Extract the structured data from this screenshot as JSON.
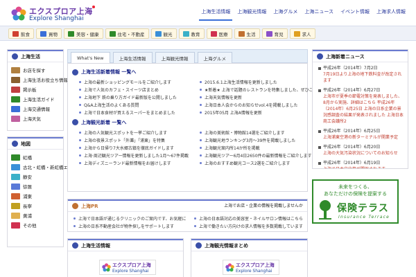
{
  "header": {
    "logo_jp": "エクスプロア上海",
    "logo_en": "Explore Shanghai",
    "nav": [
      "上海生活情報",
      "上海観光情報",
      "上海グルメ",
      "上海ニュース",
      "イベント情報",
      "上海求人情報"
    ]
  },
  "categories": [
    {
      "label": "飲食",
      "color": "#d04030"
    },
    {
      "label": "買物",
      "color": "#3a6fd8"
    },
    {
      "label": "美容・健康",
      "color": "#2f8a2a"
    },
    {
      "label": "住宅・不動産",
      "color": "#2f8a2a"
    },
    {
      "label": "観光",
      "color": "#3a8fd8"
    },
    {
      "label": "教育",
      "color": "#3ab0c8"
    },
    {
      "label": "医療",
      "color": "#d03050"
    },
    {
      "label": "生活",
      "color": "#c07030"
    },
    {
      "label": "育児",
      "color": "#8a50c8"
    },
    {
      "label": "求人",
      "color": "#e0a020"
    }
  ],
  "sidebar_top": {
    "title": "上海生活",
    "items": [
      {
        "label": "お店を探す",
        "color": "#b08040"
      },
      {
        "label": "上海生活お役立ち情報",
        "color": "#8a6030"
      },
      {
        "label": "掲示板",
        "color": "#c04040"
      },
      {
        "label": "上海生活ガイド",
        "color": "#2f8a2a"
      },
      {
        "label": "上海交通情報",
        "color": "#3a6fd8"
      },
      {
        "label": "上海天気",
        "color": "#c060a0"
      }
    ]
  },
  "sidebar_bottom": {
    "title": "地図",
    "items": [
      {
        "label": "虹橋",
        "color": "#2f8a2a"
      },
      {
        "label": "古北・虹橋・新虹橋エリア",
        "color": "#3a8fd8"
      },
      {
        "label": "静安",
        "color": "#3ab0c8"
      },
      {
        "label": "徐匯",
        "color": "#5a7ad8"
      },
      {
        "label": "浦東",
        "color": "#d06030"
      },
      {
        "label": "長寧",
        "color": "#c0a020"
      },
      {
        "label": "黄浦",
        "color": "#e0b050"
      },
      {
        "label": "その他",
        "color": "#d03050"
      }
    ]
  },
  "tabs": [
    "What's New",
    "上海生活情報",
    "上海観光情報",
    "上海グルメ"
  ],
  "whats_new": {
    "title1": "上海生活新着情報 一覧へ",
    "left1": [
      "上海の最新ショッピングモールをご紹介します",
      "上海で人気のカフェ・スイーツ店まとめ",
      "上海地下 鉄の乗り方ガイド最新版を公開しました",
      "Q&A上海生活のよくある質問",
      "上海で日本食材が買えるスーパーをまとめました"
    ],
    "right1": [
      "2015.6.1上海生活情報を更新しました",
      "★新着★ 上海で話題のレストランを特集しました、ぜひご覧ください",
      "上海天気情報を更新",
      "上海日本人会からのお知らせvol.4を掲載しました",
      "2015年05月 上海A情報を更新"
    ],
    "title2": "上海観光新着 一覧へ",
    "left2": [
      "上海の人気観光スポットを一挙ご紹介します",
      "上海の夜景スポット「外灘」「浦東」を特集",
      "上海から日帰り7大水郷古鎮を徹底ガイドします",
      "上海·周辺観光ツアー情報を更新しました1月〜67件掲載",
      "上海ディズニーランド最新情報をお届けします"
    ],
    "right2": [
      "上海の美術館・博物館14選をご紹介します",
      "上海観光地ランキング3月〜39件を掲載しました",
      "上海観光案内所14か所を掲載",
      "上海観光ツアー6月4日2650件の最新情報をご紹介します",
      "上海のおすすめ観光コース2選をご紹介します"
    ]
  },
  "pr": {
    "title": "上海PR",
    "right_text": "上海でお店・企業の情報を掲載しませんか",
    "left": [
      "上海で日本語が通じるクリニックのご案内です、お気軽に",
      "上海の日系不動産会社が物件探しをサポートします"
    ],
    "right": [
      "上海の日本語対応の美容室・ネイルサロン情報はこちら",
      "上海で働きたい方向けの求人情報を多数掲載しています"
    ]
  },
  "bottom_boxes": [
    "上海生活情報",
    "上海観光情報まとめ"
  ],
  "right_news": {
    "title": "上海新着ニュース",
    "items": [
      {
        "date": "平成26年（2014年）7月2日",
        "desc": "7月19日より上海の地下鉄料金が改定されます"
      },
      {
        "date": "平成26年（2014年）6月27日",
        "desc": "上海市が夏季の節電対策を発表しました、8月から実施、詳細はこちら 平成26年（2014年）6月25日 上海の日系企業の景況感調査の結果が発表されました 上海日本商工会議所2"
      },
      {
        "date": "平成26年（2014年）6月25日",
        "desc": "上海浦東空港の新ターミナルが開業予定"
      },
      {
        "date": "平成26年（2014年）6月20日",
        "desc": "上海の大気汚染状況についてのお知らせ"
      },
      {
        "date": "平成26年（2014年）6月19日",
        "desc": "上海で日本文化祭が開催されます"
      }
    ]
  },
  "ad": {
    "line1": "未来をつくる、",
    "line2": "あなただけの保険を提案する",
    "brand": "保険テラス",
    "brand_en": "Insurance Terrace"
  }
}
